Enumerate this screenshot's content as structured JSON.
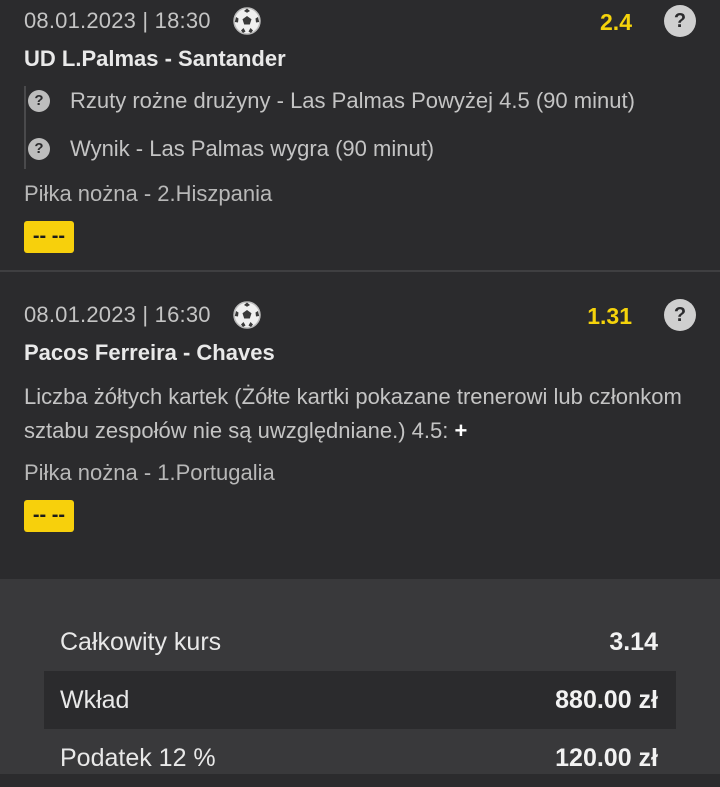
{
  "bets": [
    {
      "datetime": "08.01.2023 | 18:30",
      "sport_icon": "soccer-ball-icon",
      "odds": "2.4",
      "help": "?",
      "match": "UD L.Palmas - Santander",
      "selections": [
        {
          "icon": "?",
          "text": "Rzuty rożne drużyny - Las Palmas Powyżej 4.5 (90 minut)"
        },
        {
          "icon": "?",
          "text": "Wynik - Las Palmas wygra (90 minut)"
        }
      ],
      "league": "Piłka nożna - 2.Hiszpania",
      "status": "-- --"
    },
    {
      "datetime": "08.01.2023 | 16:30",
      "sport_icon": "soccer-ball-icon",
      "odds": "1.31",
      "help": "?",
      "match": "Pacos Ferreira - Chaves",
      "selection_text": "Liczba żółtych kartek (Żółte kartki pokazane trenerowi lub członkom sztabu zespołów nie są uwzględniane.) 4.5:",
      "selection_mark": "+",
      "league": "Piłka nożna - 1.Portugalia",
      "status": "-- --"
    }
  ],
  "summary": {
    "total_odds_label": "Całkowity kurs",
    "total_odds_value": "3.14",
    "stake_label": "Wkład",
    "stake_value": "880.00 zł",
    "tax_label": "Podatek 12 %",
    "tax_value": "120.00 zł"
  },
  "colors": {
    "odds": "#f5d30b",
    "status_badge": "#f7d00c",
    "background": "#2b2b2d"
  }
}
